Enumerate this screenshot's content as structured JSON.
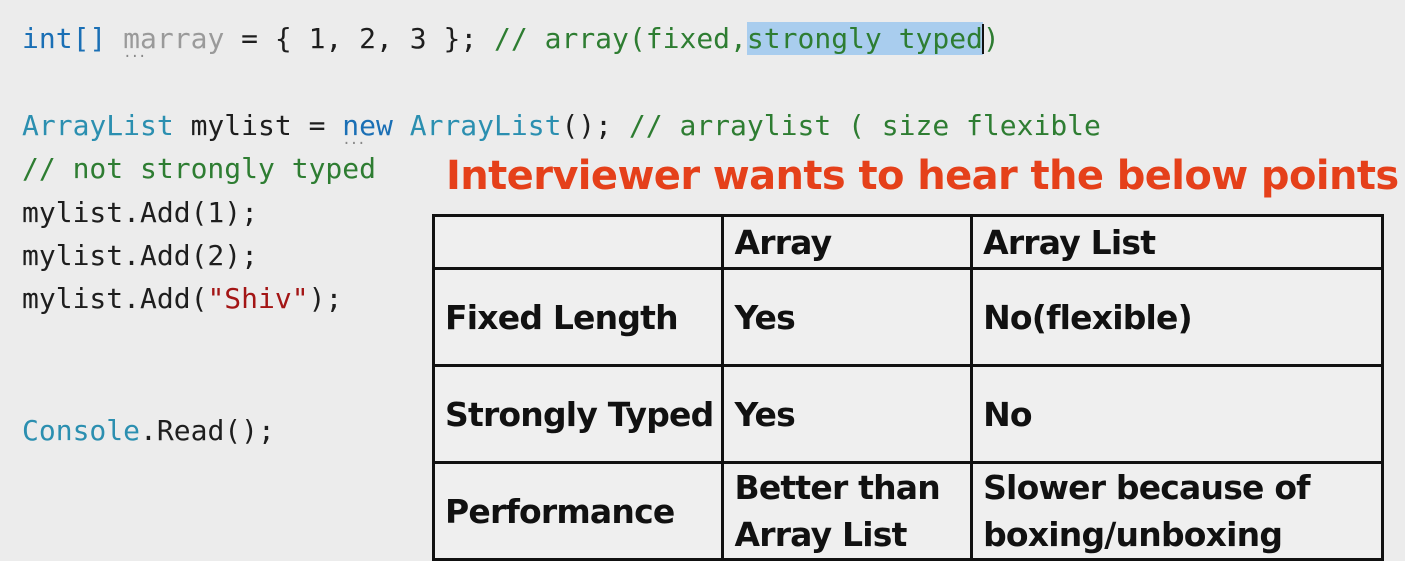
{
  "code": {
    "line1": {
      "type_kw": "int[]",
      "var_name": "marray",
      "assign": " = { 1, 2, 3 }; ",
      "comment_start": "// array(fixed,",
      "comment_selected": "strongly typed",
      "comment_end": ")"
    },
    "line2": {
      "type": "ArrayList",
      "var_part": " mylist = ",
      "new_kw": "new",
      "space": " ",
      "ctor": "ArrayList",
      "call_end": "(); ",
      "comment": "// arraylist ( size flexible"
    },
    "line3": {
      "comment": "// not strongly typed"
    },
    "line4": {
      "text": "mylist.Add(1);"
    },
    "line5": {
      "text": "mylist.Add(2);"
    },
    "line6": {
      "prefix": "mylist.Add(",
      "string": "\"Shiv\"",
      "suffix": ");"
    },
    "line7": {
      "type": "Console",
      "call": ".Read();"
    }
  },
  "overlay": {
    "title": "Interviewer wants to hear the below points",
    "title_color": "#e5401a"
  },
  "comparison_table": {
    "headers": [
      "",
      "Array",
      "Array List"
    ],
    "rows": [
      {
        "feature": "Fixed Length",
        "array": "Yes",
        "array_list": "No(flexible)"
      },
      {
        "feature": "Strongly Typed",
        "array": "Yes",
        "array_list": "No"
      },
      {
        "feature": "Performance",
        "array": "Better than Array List",
        "array_list": "Slower because of boxing/unboxing"
      }
    ]
  },
  "colors": {
    "keyword": "#1a6fb5",
    "type": "#2b8fb0",
    "comment": "#2e7d32",
    "string": "#a31515",
    "selection": "#a9cdee"
  }
}
